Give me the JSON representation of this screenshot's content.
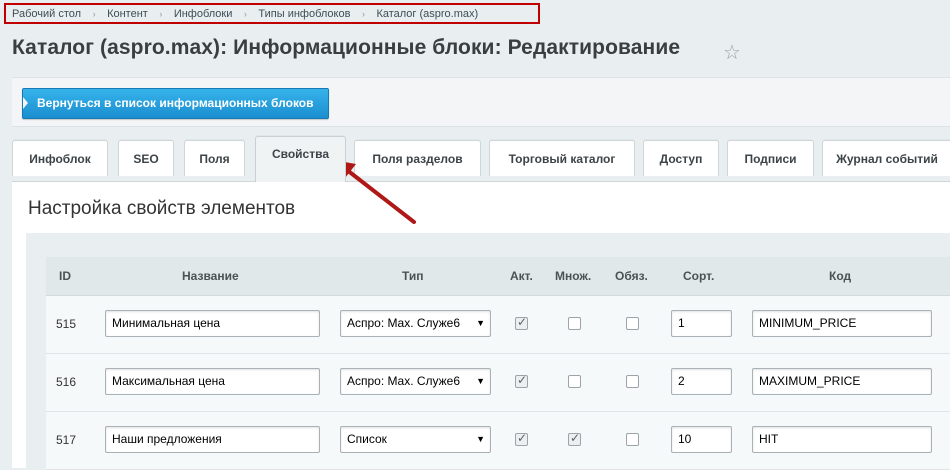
{
  "breadcrumb": {
    "items": [
      "Рабочий стол",
      "Контент",
      "Инфоблоки",
      "Типы инфоблоков",
      "Каталог (aspro.max)"
    ],
    "separator": "›"
  },
  "page": {
    "title": "Каталог (aspro.max): Информационные блоки: Редактирование",
    "star_icon": "☆"
  },
  "toolbar": {
    "back_label": "Вернуться в список информационных блоков"
  },
  "tabs": [
    {
      "label": "Инфоблок",
      "active": false
    },
    {
      "label": "SEO",
      "active": false
    },
    {
      "label": "Поля",
      "active": false
    },
    {
      "label": "Свойства",
      "active": true
    },
    {
      "label": "Поля разделов",
      "active": false
    },
    {
      "label": "Торговый каталог",
      "active": false
    },
    {
      "label": "Доступ",
      "active": false
    },
    {
      "label": "Подписи",
      "active": false
    },
    {
      "label": "Журнал событий",
      "active": false
    }
  ],
  "section": {
    "title": "Настройка свойств элементов"
  },
  "table": {
    "headers": {
      "id": "ID",
      "name": "Название",
      "type": "Тип",
      "active": "Акт.",
      "multiple": "Множ.",
      "required": "Обяз.",
      "sort": "Сорт.",
      "code": "Код"
    },
    "rows": [
      {
        "id": "515",
        "name": "Минимальная цена",
        "type": "Аспро: Max. Служе6",
        "active": true,
        "multiple": false,
        "required": false,
        "sort": "1",
        "code": "MINIMUM_PRICE"
      },
      {
        "id": "516",
        "name": "Максимальная цена",
        "type": "Аспро: Max. Служе6",
        "active": true,
        "multiple": false,
        "required": false,
        "sort": "2",
        "code": "MAXIMUM_PRICE"
      },
      {
        "id": "517",
        "name": "Наши предложения",
        "type": "Список",
        "active": true,
        "multiple": true,
        "required": false,
        "sort": "10",
        "code": "HIT"
      }
    ]
  },
  "colors": {
    "accent_button": "#1b8ed0",
    "highlight_border": "#c00000",
    "annotation_arrow": "#b01818"
  }
}
